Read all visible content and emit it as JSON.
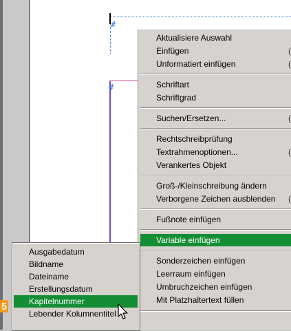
{
  "step_badge": "5",
  "context_menu": {
    "items": [
      {
        "label": "Aktualisiere Auswahl"
      },
      {
        "label": "Einfügen",
        "shortcut": "("
      },
      {
        "label": "Unformatiert einfügen",
        "shortcut": "("
      },
      {
        "label": "Schriftart"
      },
      {
        "label": "Schriftgrad"
      },
      {
        "label": "Suchen/Ersetzen...",
        "shortcut": "("
      },
      {
        "label": "Rechtschreibprüfung"
      },
      {
        "label": "Textrahmenoptionen...",
        "shortcut": "("
      },
      {
        "label": "Verankertes Objekt"
      },
      {
        "label": "Groß-/Kleinschreibung ändern"
      },
      {
        "label": "Verborgene Zeichen ausblenden",
        "shortcut": "("
      },
      {
        "label": "Fußnote einfügen"
      },
      {
        "label": "Variable einfügen"
      },
      {
        "label": "Sonderzeichen einfügen"
      },
      {
        "label": "Leerraum einfügen"
      },
      {
        "label": "Umbruchzeichen einfügen"
      },
      {
        "label": "Mit Platzhaltertext füllen"
      }
    ]
  },
  "submenu": {
    "items": [
      {
        "label": "Ausgabedatum"
      },
      {
        "label": "Bildname"
      },
      {
        "label": "Dateiname"
      },
      {
        "label": "Erstellungsdatum"
      },
      {
        "label": "Kapitelnummer"
      },
      {
        "label": "Lebender Kolumnentitel"
      }
    ]
  },
  "colors": {
    "highlight": "#138e34",
    "badge": "#f39a1e",
    "frame": "#3b6fd8"
  }
}
